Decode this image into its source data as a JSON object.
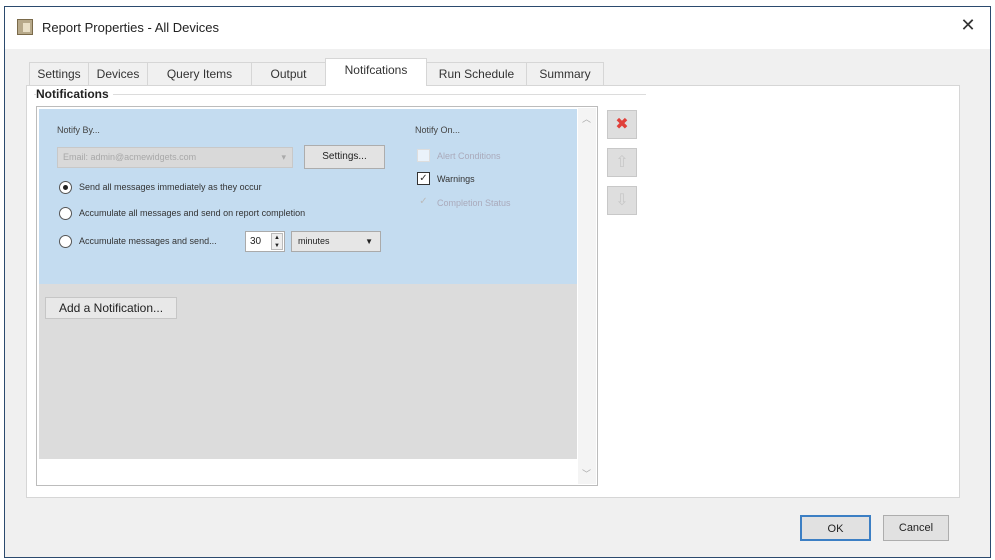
{
  "window": {
    "title": "Report Properties - All Devices",
    "close": "✕"
  },
  "tabs": [
    {
      "label": "Settings"
    },
    {
      "label": "Devices"
    },
    {
      "label": "Query Items"
    },
    {
      "label": "Output"
    },
    {
      "label": "Notifcations"
    },
    {
      "label": "Run Schedule"
    },
    {
      "label": "Summary"
    }
  ],
  "selected_tab": "Notifcations",
  "group": {
    "label": "Notifications"
  },
  "notification": {
    "notify_by_label": "Notify By...",
    "email_value": "Email: admin@acmewidgets.com",
    "settings_button": "Settings...",
    "options": [
      {
        "label": "Send all messages immediately as they occur",
        "selected": true
      },
      {
        "label": "Accumulate all messages and send on report completion",
        "selected": false
      },
      {
        "label": "Accumulate messages and send...",
        "selected": false
      }
    ],
    "interval_value": "30",
    "interval_unit": "minutes",
    "notify_on_label": "Notify On...",
    "conditions": [
      {
        "label": "Alert Conditions",
        "checked": false,
        "enabled": false
      },
      {
        "label": "Warnings",
        "checked": true,
        "enabled": true
      },
      {
        "label": "Completion Status",
        "checked": true,
        "enabled": false
      }
    ]
  },
  "add_button": "Add a Notification...",
  "side_buttons": [
    {
      "icon": "delete-icon",
      "color": "#e0403a"
    },
    {
      "icon": "move-up-icon"
    },
    {
      "icon": "move-down-icon"
    }
  ],
  "footer": {
    "ok": "OK",
    "cancel": "Cancel"
  }
}
